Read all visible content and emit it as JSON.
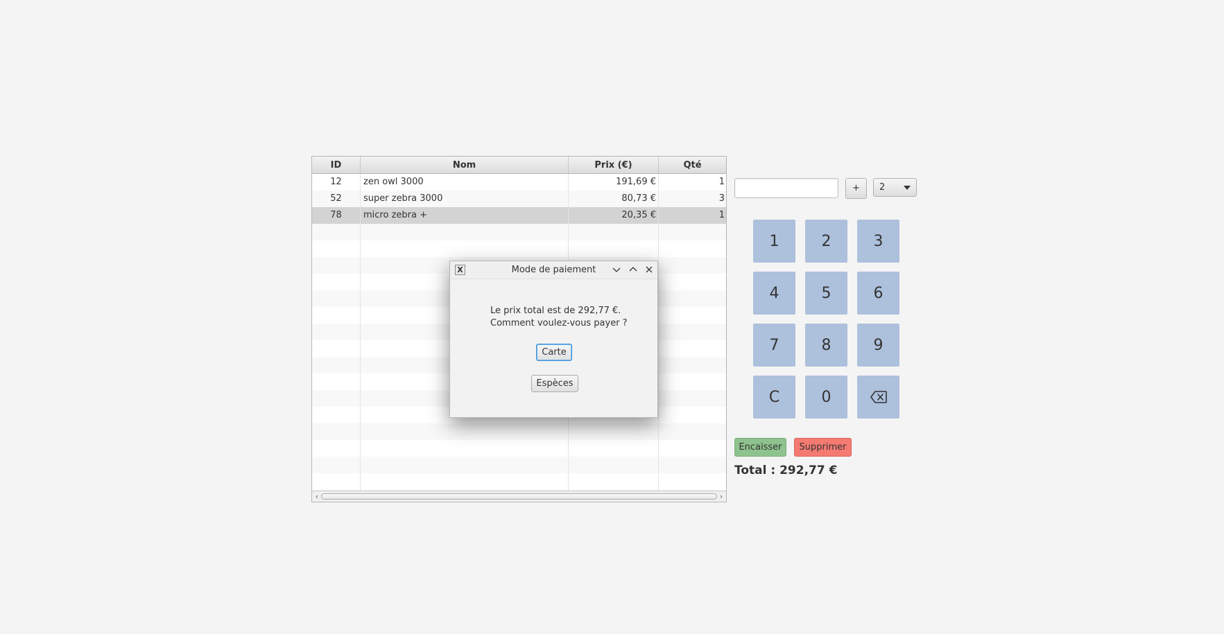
{
  "table": {
    "headers": {
      "id": "ID",
      "nom": "Nom",
      "prix": "Prix (€)",
      "qte": "Qté"
    },
    "rows": [
      {
        "id": "12",
        "nom": "zen owl 3000",
        "prix": "191,69 €",
        "qte": "1"
      },
      {
        "id": "52",
        "nom": "super zebra 3000",
        "prix": "80,73 €",
        "qte": "3"
      },
      {
        "id": "78",
        "nom": "micro zebra +",
        "prix": "20,35 €",
        "qte": "1"
      }
    ],
    "selected_row": 2
  },
  "input": {
    "barcode_value": "",
    "plus_label": "+",
    "quantity_selected": "2"
  },
  "keypad": {
    "keys": [
      "1",
      "2",
      "3",
      "4",
      "5",
      "6",
      "7",
      "8",
      "9",
      "C",
      "0",
      "backspace-icon"
    ],
    "key_color": "#adc0dc"
  },
  "actions": {
    "encaisser_label": "Encaisser",
    "encaisser_color": "#8ec28e",
    "supprimer_label": "Supprimer",
    "supprimer_color": "#f47a72"
  },
  "total_label": "Total : 292,77 €",
  "dialog": {
    "title": "Mode de paiement",
    "message": "Le prix total est de 292,77 €.\nComment voulez-vous payer ?",
    "carte_label": "Carte",
    "especes_label": "Espèces",
    "icons": [
      "app-x-icon",
      "minimize-icon",
      "maximize-icon",
      "close-icon"
    ]
  }
}
